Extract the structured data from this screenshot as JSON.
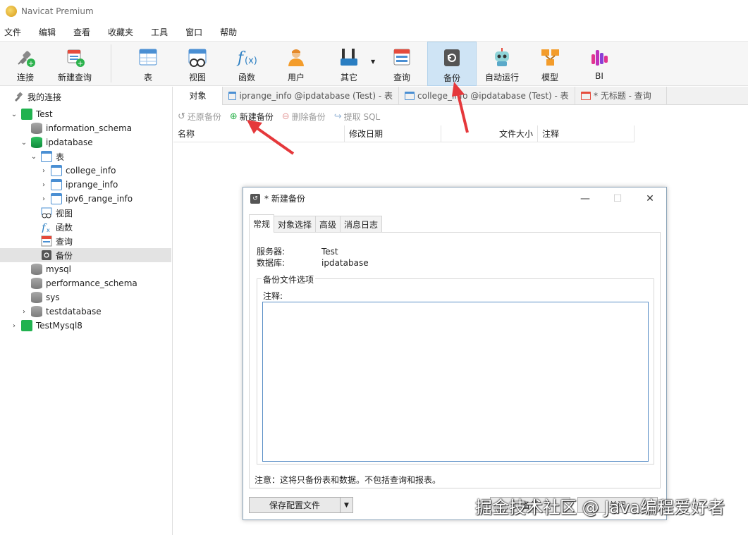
{
  "window": {
    "title": "Navicat Premium"
  },
  "menu": [
    "文件",
    "编辑",
    "查看",
    "收藏夹",
    "工具",
    "窗口",
    "帮助"
  ],
  "toolbar": [
    {
      "label": "连接",
      "icon": "plug-icon"
    },
    {
      "label": "新建查询",
      "icon": "new-query-icon"
    },
    {
      "label": "表",
      "icon": "table-icon"
    },
    {
      "label": "视图",
      "icon": "view-icon"
    },
    {
      "label": "函数",
      "icon": "function-icon"
    },
    {
      "label": "用户",
      "icon": "user-icon"
    },
    {
      "label": "其它",
      "icon": "tools-icon"
    },
    {
      "label": "查询",
      "icon": "query-icon"
    },
    {
      "label": "备份",
      "icon": "backup-icon"
    },
    {
      "label": "自动运行",
      "icon": "robot-icon"
    },
    {
      "label": "模型",
      "icon": "model-icon"
    },
    {
      "label": "BI",
      "icon": "bi-icon"
    }
  ],
  "sidebar": {
    "root": "我的连接",
    "items": [
      "Test",
      "information_schema",
      "ipdatabase",
      "表",
      "college_info",
      "iprange_info",
      "ipv6_range_info",
      "视图",
      "函数",
      "查询",
      "备份",
      "mysql",
      "performance_schema",
      "sys",
      "testdatabase",
      "TestMysql8"
    ]
  },
  "tabs": {
    "objects": "对象",
    "tab1": "iprange_info @ipdatabase (Test) - 表",
    "tab2": "college_info @ipdatabase (Test) - 表",
    "tab3": "* 无标题 - 查询"
  },
  "backup_toolbar": {
    "restore": "还原备份",
    "new": "新建备份",
    "delete": "删除备份",
    "extract": "提取 SQL"
  },
  "columns": [
    "名称",
    "修改日期",
    "文件大小",
    "注释"
  ],
  "dialog": {
    "title": "* 新建备份",
    "tabs": [
      "常规",
      "对象选择",
      "高级",
      "消息日志"
    ],
    "server_label": "服务器:",
    "server_value": "Test",
    "db_label": "数据库:",
    "db_value": "ipdatabase",
    "group_label": "备份文件选项",
    "note_label": "注释:",
    "note_value": "",
    "footnote": "注意：这将只备份表和数据。不包括查询和报表。",
    "save_config": "保存配置文件",
    "backup_button": "备份",
    "close_button": "关闭"
  },
  "watermark": "掘金技术社区 @ Java编程爱好者",
  "colors": {
    "accent": "#cfe4f5",
    "arrow": "#e5383b",
    "db_active": "#1aa64a"
  }
}
